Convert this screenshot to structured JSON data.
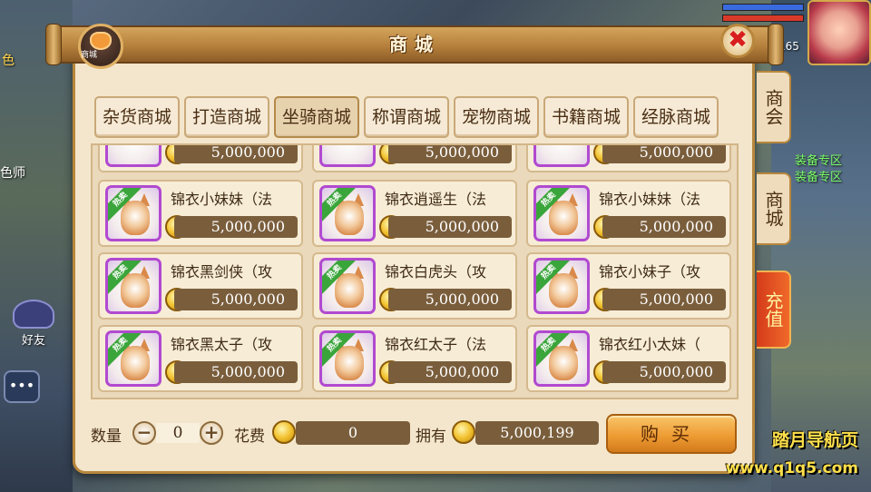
{
  "title": "商城",
  "shop_icon_label": "商城",
  "close_symbol": "✖",
  "tabs": [
    {
      "label": "杂货商城",
      "active": false
    },
    {
      "label": "打造商城",
      "active": false
    },
    {
      "label": "坐骑商城",
      "active": true
    },
    {
      "label": "称谓商城",
      "active": false
    },
    {
      "label": "宠物商城",
      "active": false
    },
    {
      "label": "书籍商城",
      "active": false
    },
    {
      "label": "经脉商城",
      "active": false
    }
  ],
  "partial_row_price": "5,000,000",
  "hot_label": "热卖",
  "items": [
    {
      "name": "锦衣小妹妹（法",
      "price": "5,000,000"
    },
    {
      "name": "锦衣逍遥生（法",
      "price": "5,000,000"
    },
    {
      "name": "锦衣小妹妹（法",
      "price": "5,000,000"
    },
    {
      "name": "锦衣黑剑侠（攻",
      "price": "5,000,000"
    },
    {
      "name": "锦衣白虎头（攻",
      "price": "5,000,000"
    },
    {
      "name": "锦衣小妹子（攻",
      "price": "5,000,000"
    },
    {
      "name": "锦衣黑太子（攻",
      "price": "5,000,000"
    },
    {
      "name": "锦衣红太子（法",
      "price": "5,000,000"
    },
    {
      "name": "锦衣红小太妹（",
      "price": "5,000,000"
    }
  ],
  "bottom": {
    "quantity_label": "数量",
    "quantity_value": "0",
    "minus": "−",
    "plus": "+",
    "cost_label": "花费",
    "cost_value": "0",
    "owned_label": "拥有",
    "owned_value": "5,000,199",
    "buy_label": "购买"
  },
  "side_tabs": {
    "guild": "商会",
    "mall": "商城",
    "recharge": "充值"
  },
  "background": {
    "left_texts": [
      "色",
      "色师",
      "好友"
    ],
    "friend_label": "好友",
    "right_texts": [
      "装备专区",
      "装备专区",
      "165"
    ],
    "watermark_line1": "踏月导航页",
    "watermark_line2": "www.q1q5.com"
  }
}
